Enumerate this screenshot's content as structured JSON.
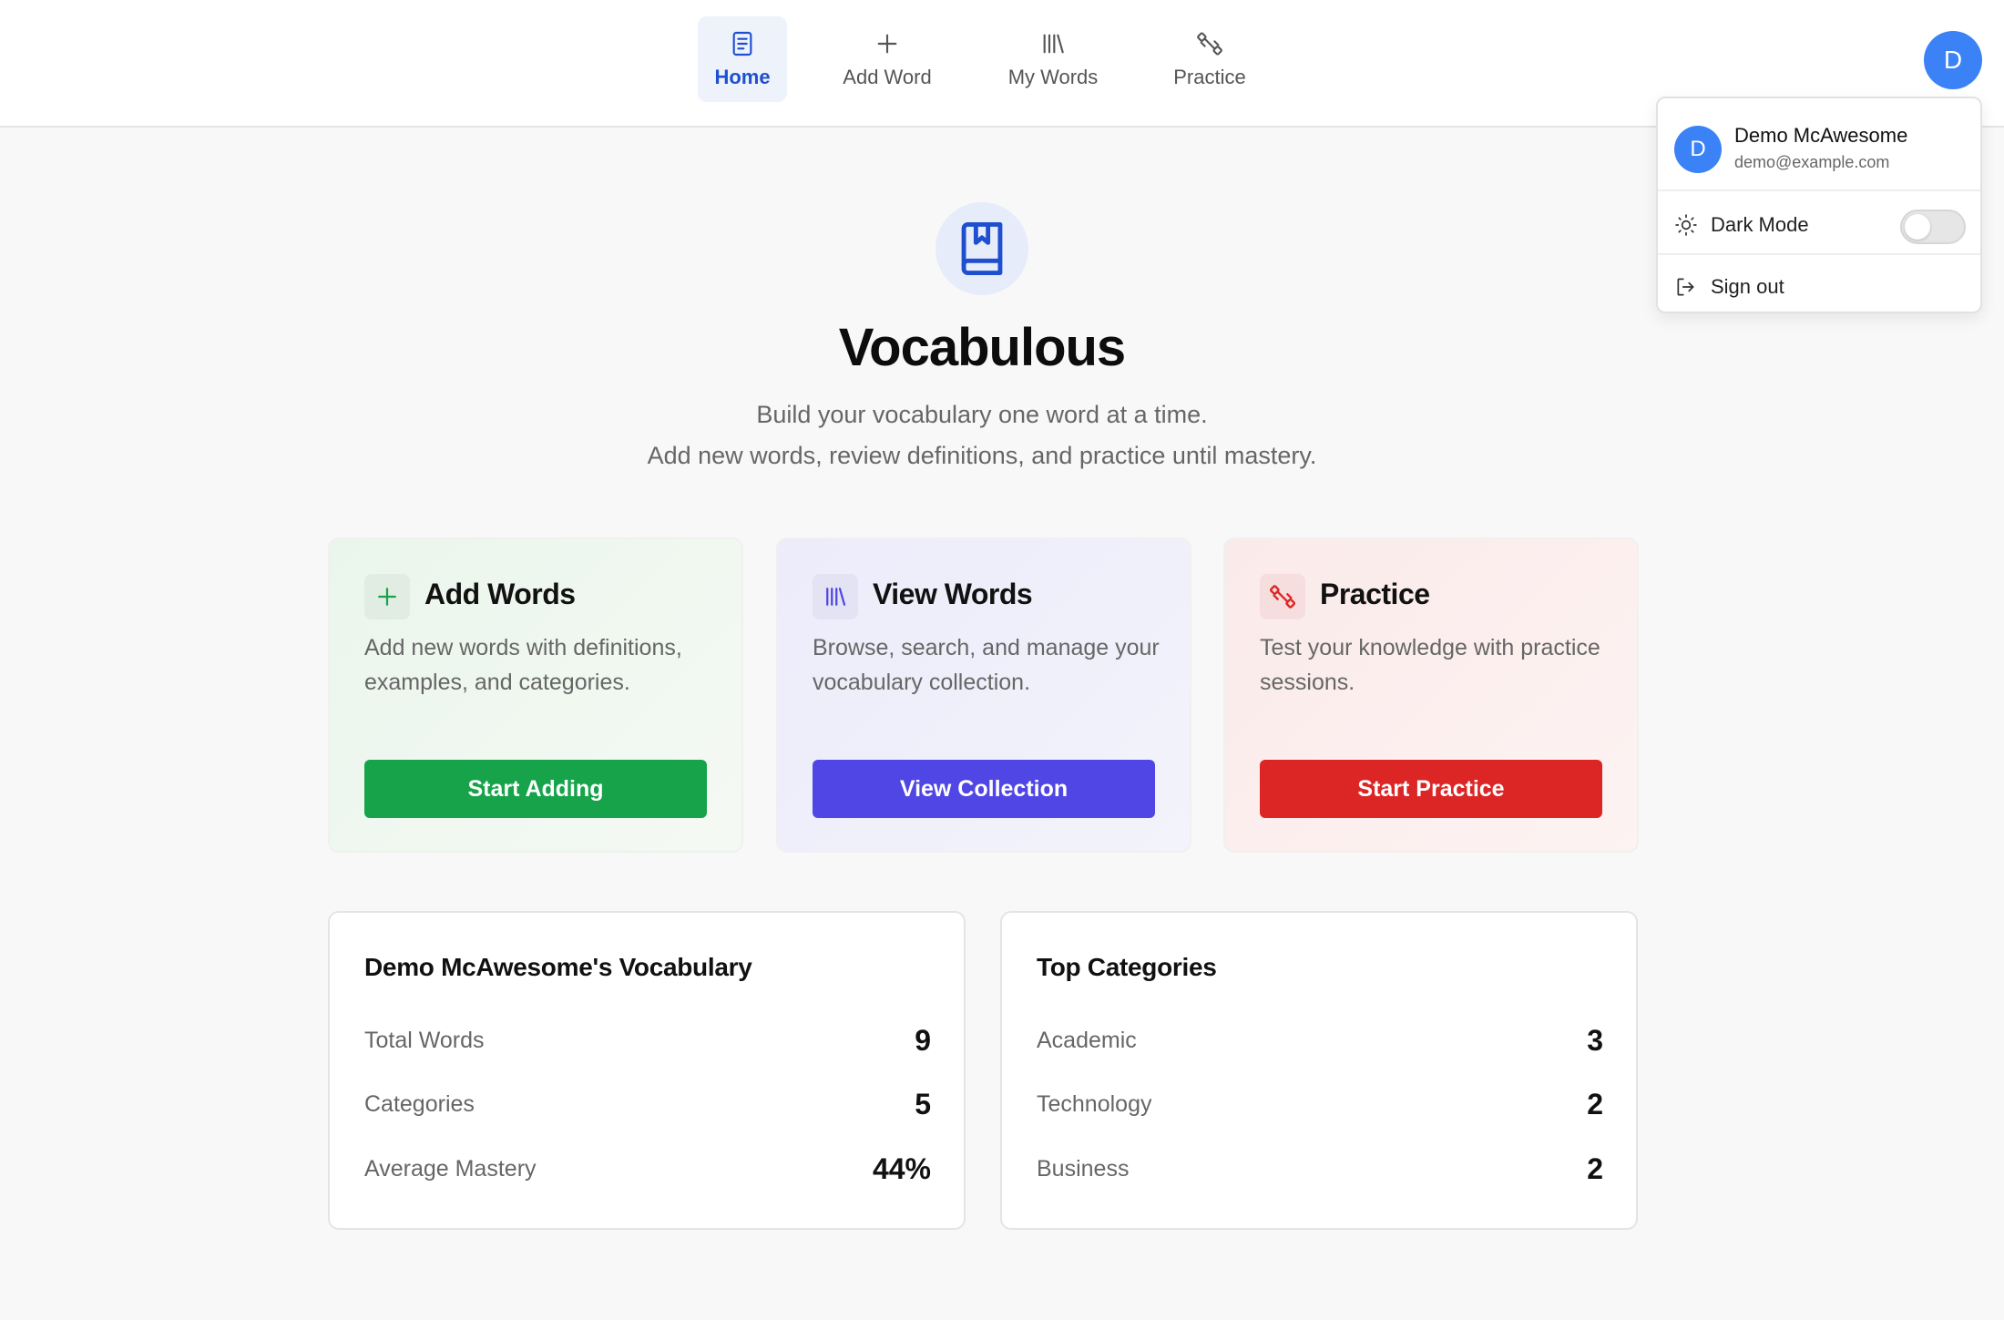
{
  "nav": {
    "items": [
      {
        "label": "Home",
        "icon": "document-icon",
        "active": true
      },
      {
        "label": "Add Word",
        "icon": "plus-icon",
        "active": false
      },
      {
        "label": "My Words",
        "icon": "library-icon",
        "active": false
      },
      {
        "label": "Practice",
        "icon": "dumbbell-icon",
        "active": false
      }
    ],
    "avatar_letter": "D"
  },
  "user_menu": {
    "avatar_letter": "D",
    "name": "Demo McAwesome",
    "email": "demo@example.com",
    "dark_mode_label": "Dark Mode",
    "dark_mode_on": false,
    "sign_out_label": "Sign out"
  },
  "hero": {
    "title": "Vocabulous",
    "subtitle_line1": "Build your vocabulary one word at a time.",
    "subtitle_line2": "Add new words, review definitions, and practice until mastery."
  },
  "cards": [
    {
      "title": "Add Words",
      "desc": "Add new words with definitions, examples, and categories.",
      "button": "Start Adding",
      "accent": "#16a34a"
    },
    {
      "title": "View Words",
      "desc": "Browse, search, and manage your vocabulary collection.",
      "button": "View Collection",
      "accent": "#4f46e5"
    },
    {
      "title": "Practice",
      "desc": "Test your knowledge with practice sessions.",
      "button": "Start Practice",
      "accent": "#dc2626"
    }
  ],
  "vocab_panel": {
    "title": "Demo McAwesome's Vocabulary",
    "rows": [
      {
        "label": "Total Words",
        "value": "9"
      },
      {
        "label": "Categories",
        "value": "5"
      },
      {
        "label": "Average Mastery",
        "value": "44%"
      }
    ]
  },
  "categories_panel": {
    "title": "Top Categories",
    "rows": [
      {
        "label": "Academic",
        "value": "3"
      },
      {
        "label": "Technology",
        "value": "2"
      },
      {
        "label": "Business",
        "value": "2"
      }
    ]
  },
  "colors": {
    "primary_blue": "#3b82f6",
    "active_nav": "#1e4fcf",
    "green": "#16a34a",
    "indigo": "#4f46e5",
    "red": "#dc2626"
  }
}
